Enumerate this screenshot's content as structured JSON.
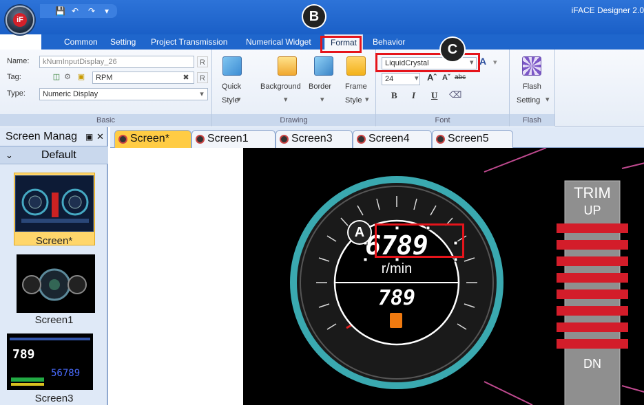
{
  "window": {
    "app_title": "iFACE Designer 2.0"
  },
  "menu": {
    "items": [
      "Common",
      "Setting",
      "Project Transmission",
      "Numerical Widget",
      "Format",
      "Behavior"
    ]
  },
  "basic": {
    "name_label": "Name:",
    "name_value": "kNumInputDisplay_26",
    "tag_label": "Tag:",
    "tag_value": "RPM",
    "type_label": "Type:",
    "type_value": "Numeric Display",
    "r_button": "R",
    "group_label": "Basic"
  },
  "drawing": {
    "quick_style_1": "Quick",
    "quick_style_2": "Style",
    "background": "Background",
    "border": "Border",
    "frame_1": "Frame",
    "frame_2": "Style",
    "group_label": "Drawing"
  },
  "font": {
    "family": "LiquidCrystal",
    "size": "24",
    "bold": "B",
    "italic": "I",
    "underline": "U",
    "strike": "abc",
    "group_label": "Font"
  },
  "flash": {
    "label_1": "Flash",
    "label_2": "Setting",
    "group_label": "Flash"
  },
  "tabs": [
    "Screen*",
    "Screen1",
    "Screen3",
    "Screen4",
    "Screen5"
  ],
  "sidebar": {
    "title": "Screen Manag",
    "group": "Default",
    "screens": [
      "Screen*",
      "Screen1",
      "Screen3"
    ],
    "thumb3_digits_a": "789",
    "thumb3_digits_b": "56789"
  },
  "gauge": {
    "main_value": "6789",
    "unit": "r/min",
    "sub_value": "789",
    "trim_label": "TRIM",
    "up_label": "UP",
    "dn_label": "DN"
  },
  "markers": {
    "a": "A",
    "b": "B",
    "c": "C"
  },
  "colors": {
    "accent_blue": "#1f66cc",
    "active_tab": "#ffcc44",
    "highlight_red": "#e5141b",
    "gauge_teal": "#3aa9b0"
  }
}
